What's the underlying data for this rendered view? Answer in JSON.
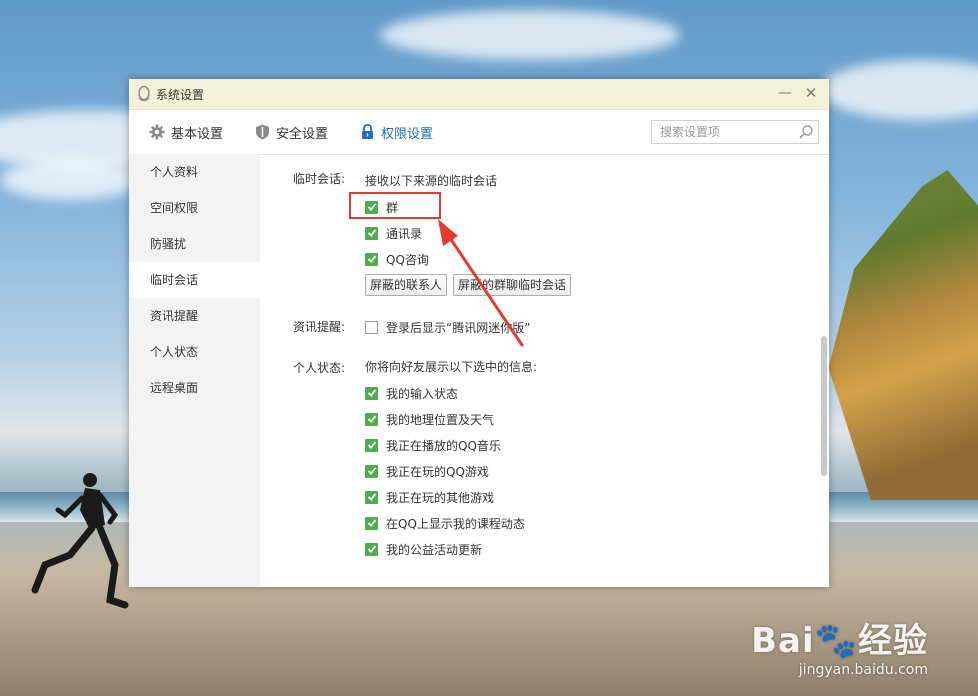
{
  "window": {
    "title": "系统设置",
    "minimize_label": "—",
    "close_label": "✕"
  },
  "tabs": [
    {
      "label": "基本设置",
      "icon": "gear-icon"
    },
    {
      "label": "安全设置",
      "icon": "shield-icon"
    },
    {
      "label": "权限设置",
      "icon": "lock-icon",
      "active": true
    }
  ],
  "search": {
    "placeholder": "搜索设置项",
    "value": ""
  },
  "sidebar": {
    "items": [
      {
        "label": "个人资料"
      },
      {
        "label": "空间权限"
      },
      {
        "label": "防骚扰"
      },
      {
        "label": "临时会话",
        "active": true
      },
      {
        "label": "资讯提醒"
      },
      {
        "label": "个人状态"
      },
      {
        "label": "远程桌面"
      }
    ]
  },
  "temp_chat": {
    "label": "临时会话:",
    "heading": "接收以下来源的临时会话",
    "options": [
      {
        "label": "群",
        "checked": true
      },
      {
        "label": "通讯录",
        "checked": true
      },
      {
        "label": "QQ咨询",
        "checked": true
      }
    ],
    "buttons": {
      "blocked_contacts": "屏蔽的联系人",
      "blocked_groups": "屏蔽的群聊临时会话"
    }
  },
  "news": {
    "label": "资讯提醒:",
    "option": {
      "label": "登录后显示“腾讯网迷你版”",
      "checked": false
    }
  },
  "status": {
    "label": "个人状态:",
    "heading": "你将向好友展示以下选中的信息:",
    "options": [
      {
        "label": "我的输入状态",
        "checked": true
      },
      {
        "label": "我的地理位置及天气",
        "checked": true
      },
      {
        "label": "我正在播放的QQ音乐",
        "checked": true
      },
      {
        "label": "我正在玩的QQ游戏",
        "checked": true
      },
      {
        "label": "我正在玩的其他游戏",
        "checked": true
      },
      {
        "label": "在QQ上显示我的课程动态",
        "checked": true
      },
      {
        "label": "我的公益活动更新",
        "checked": true
      }
    ]
  },
  "watermark": {
    "logo": "Bai🐾经验",
    "url": "jingyan.baidu.com"
  },
  "colors": {
    "accent": "#1f6fbf",
    "check": "#4cae4f",
    "annotation": "#e53935",
    "titlebar": "#f4f1d9"
  }
}
